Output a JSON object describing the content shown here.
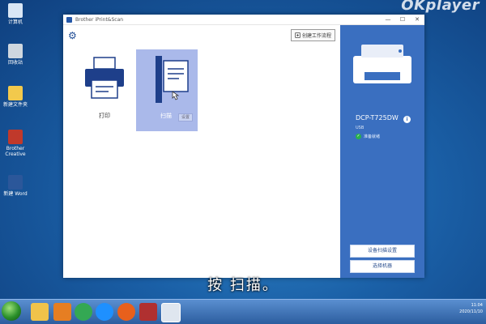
{
  "watermark": "OKplayer",
  "desktop": {
    "icons": [
      {
        "label": "计算机",
        "color": "#d9e6f5"
      },
      {
        "label": "回收站",
        "color": "#cfd7df"
      },
      {
        "label": "新建文件夹",
        "color": "#f2c94c"
      },
      {
        "label": "Brother Creative",
        "color": "#c0392b"
      },
      {
        "label": "新建 Word",
        "color": "#2b579a"
      }
    ]
  },
  "window": {
    "title": "Brother iPrint&Scan",
    "controls": {
      "minimize": "—",
      "maximize": "☐",
      "close": "✕"
    },
    "toolbar": {
      "create_workflow": "创建工作流程"
    },
    "tiles": [
      {
        "label": "打印"
      },
      {
        "label": "扫描",
        "tag": "设置"
      }
    ],
    "device": {
      "name": "DCP-T725DW",
      "connection": "USB",
      "status": "准备就绪",
      "buttons": [
        "设备扫描设置",
        "选择机器"
      ]
    }
  },
  "subtitle": "按 扫描。",
  "taskbar": {
    "items": [
      {
        "name": "explorer",
        "color": "#f0c34a"
      },
      {
        "name": "media",
        "color": "#e67e22"
      },
      {
        "name": "chrome",
        "color": "#34a853"
      },
      {
        "name": "ie",
        "color": "#1e90ff"
      },
      {
        "name": "firefox",
        "color": "#e8601c"
      },
      {
        "name": "brother-utilities",
        "color": "#b03030"
      },
      {
        "name": "iprint-scan",
        "color": "#dfe6ef"
      }
    ],
    "time": "11:04",
    "date": "2020/11/10"
  },
  "colors": {
    "accent": "#3a6fc0",
    "tile_selected": "#aab9ea"
  }
}
